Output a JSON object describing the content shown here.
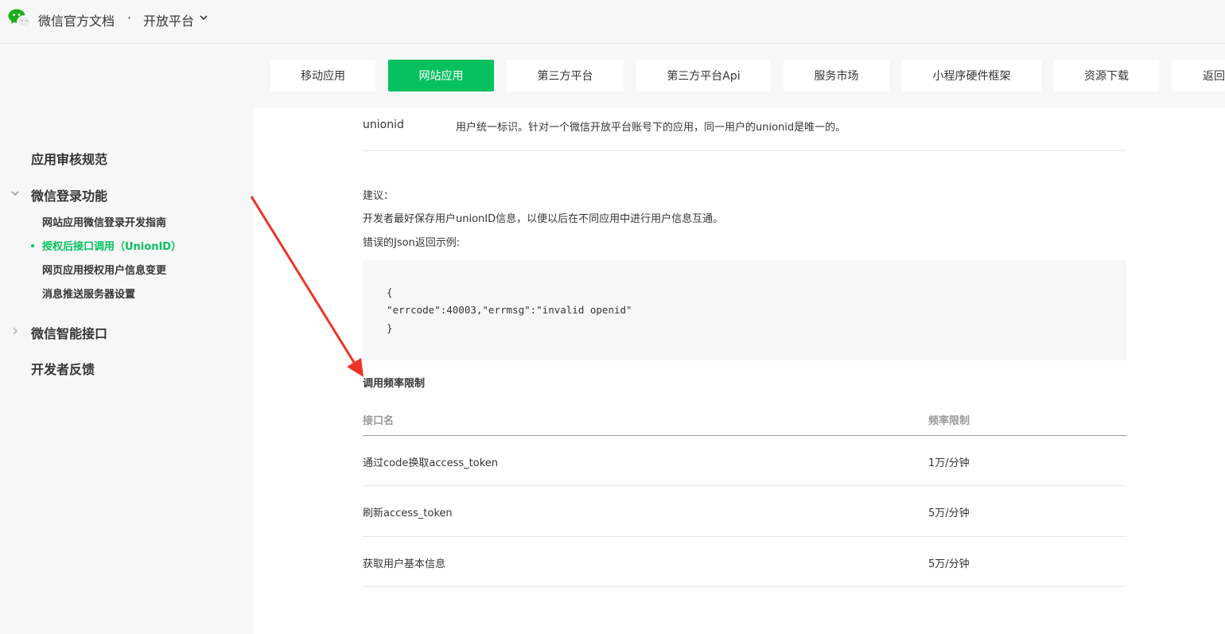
{
  "header": {
    "brand": "微信官方文档",
    "separator": "·",
    "platform": "开放平台"
  },
  "tabs": [
    {
      "label": "移动应用",
      "active": false
    },
    {
      "label": "网站应用",
      "active": true
    },
    {
      "label": "第三方平台",
      "active": false
    },
    {
      "label": "第三方平台Api",
      "active": false
    },
    {
      "label": "服务市场",
      "active": false
    },
    {
      "label": "小程序硬件框架",
      "active": false
    },
    {
      "label": "资源下载",
      "active": false
    },
    {
      "label": "返回",
      "active": false
    }
  ],
  "sidebar": {
    "section1": "应用审核规范",
    "section2": "微信登录功能",
    "sub1": "网站应用微信登录开发指南",
    "sub2": "授权后接口调用（UnionID）",
    "sub3": "网页应用授权用户信息变更",
    "sub4": "消息推送服务器设置",
    "section3": "微信智能接口",
    "section4": "开发者反馈"
  },
  "content": {
    "param_name": "unionid",
    "param_desc": "用户统一标识。针对一个微信开放平台账号下的应用，同一用户的unionid是唯一的。",
    "advice_label": "建议：",
    "advice_text": "开发者最好保存用户unionID信息，以便以后在不同应用中进行用户信息互通。",
    "error_example_label": "错误的Json返回示例:",
    "code_lines": [
      "{",
      "\"errcode\":40003,\"errmsg\":\"invalid openid\"",
      "}"
    ],
    "rate_limit_title": "调用频率限制",
    "table": {
      "headers": [
        "接口名",
        "频率限制"
      ],
      "rows": [
        [
          "通过code换取access_token",
          "1万/分钟"
        ],
        [
          "刷新access_token",
          "5万/分钟"
        ],
        [
          "获取用户基本信息",
          "5万/分钟"
        ]
      ]
    }
  },
  "colors": {
    "accent": "#07c160",
    "arrow": "#ee3324"
  }
}
